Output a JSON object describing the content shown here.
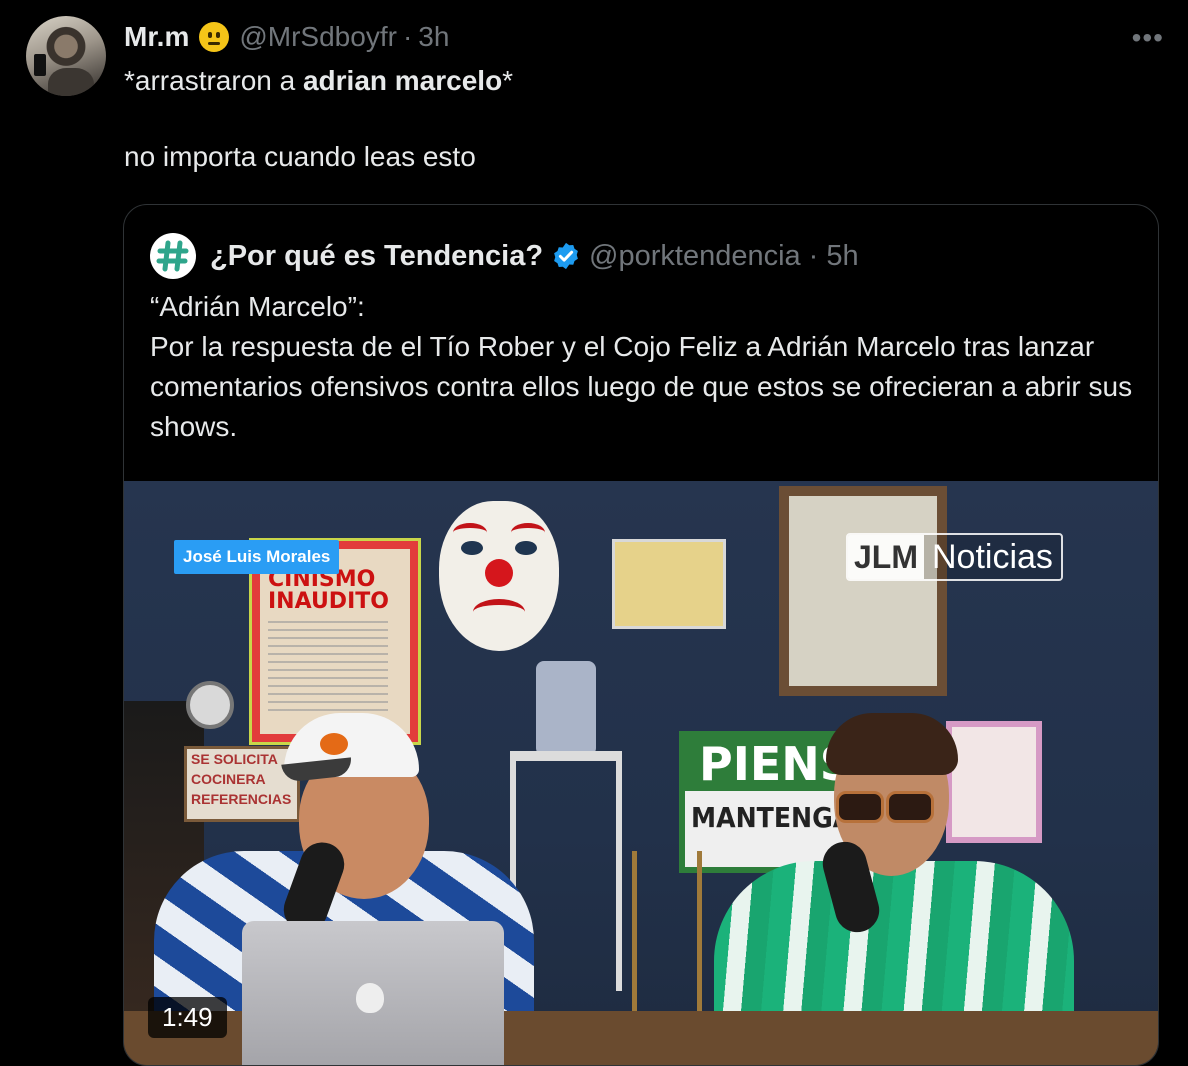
{
  "tweet": {
    "author_name": "Mr.m",
    "author_emoji": "neutral-face-emoji",
    "handle": "@MrSdboyfr",
    "separator": "·",
    "time": "3h",
    "more_label": "•••",
    "text_prefix": "*arrastraron a ",
    "text_bold": "adrian marcelo",
    "text_suffix": "*",
    "text_line2": "no importa cuando leas esto"
  },
  "quote": {
    "author_name": "¿Por qué es Tendencia?",
    "avatar_symbol": "#",
    "verified_icon": "verified-badge-icon",
    "handle": "@porktendencia",
    "separator": "·",
    "time": "5h",
    "text": "“Adrián Marcelo”:\nPor la respuesta de el Tío Rober y el Cojo Feliz a Adrián Marcelo tras lanzar comentarios ofensivos contra ellos luego de que estos se ofrecieran a abrir sus shows."
  },
  "video": {
    "duration": "1:49",
    "name_tag": "José Luis Morales",
    "brand_left": "JLM",
    "brand_right": "Noticias",
    "poster_title": "CINISMO\nINAUDITO",
    "sign_top": "PIENS",
    "sign_bottom": "MANTENGA",
    "left_sign_line1": "SE SOLICITA",
    "left_sign_line2": "COCINERA",
    "left_sign_line3": "REFERENCIAS"
  },
  "colors": {
    "background": "#000000",
    "text": "#e7e9ea",
    "muted": "#71767b",
    "border": "#2f3336",
    "verified": "#1d9bf0"
  }
}
